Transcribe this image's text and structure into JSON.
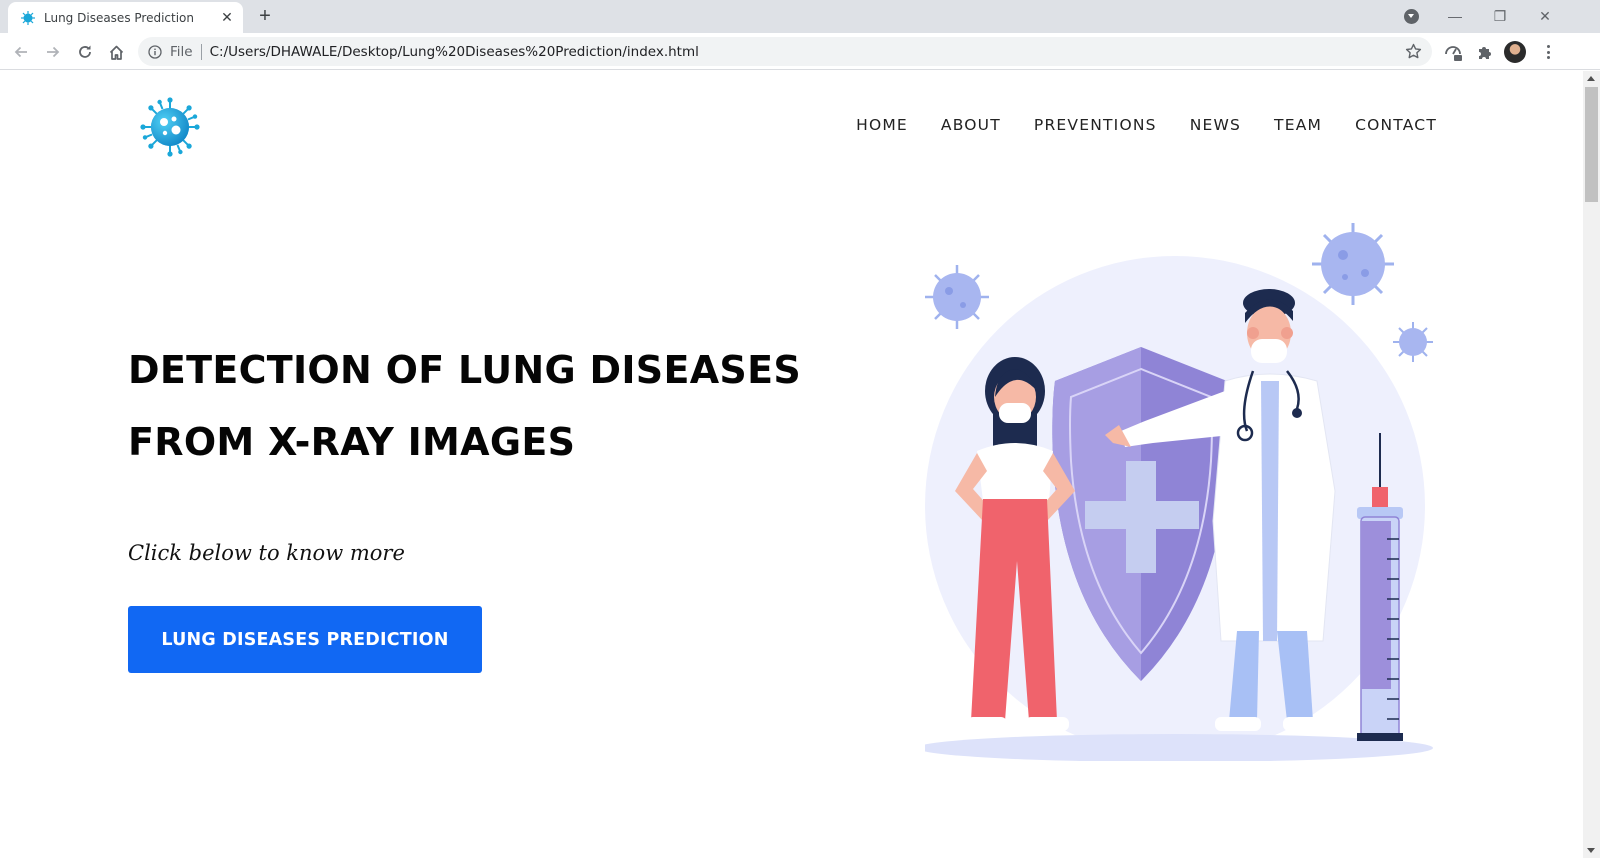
{
  "browser": {
    "tab_title": "Lung Diseases Prediction",
    "url_scheme": "File",
    "url": "C:/Users/DHAWALE/Desktop/Lung%20Diseases%20Prediction/index.html"
  },
  "site": {
    "nav": [
      "HOME",
      "ABOUT",
      "PREVENTIONS",
      "NEWS",
      "TEAM",
      "CONTACT"
    ],
    "hero": {
      "title_line1": "DETECTION OF LUNG DISEASES",
      "title_line2": "FROM X-RAY IMAGES",
      "subtitle": "Click below to know more",
      "button_label": "LUNG DISEASES PREDICTION"
    }
  },
  "colors": {
    "accent": "#1168f3",
    "logo": "#1aa7d9",
    "shield": "#8f84d6",
    "virus": "#a8b6f0"
  },
  "icons": [
    "virus-logo-icon",
    "back-arrow-icon",
    "forward-arrow-icon",
    "reload-icon",
    "home-icon",
    "info-icon",
    "star-icon",
    "extension-icon",
    "avatar",
    "menu-icon"
  ]
}
